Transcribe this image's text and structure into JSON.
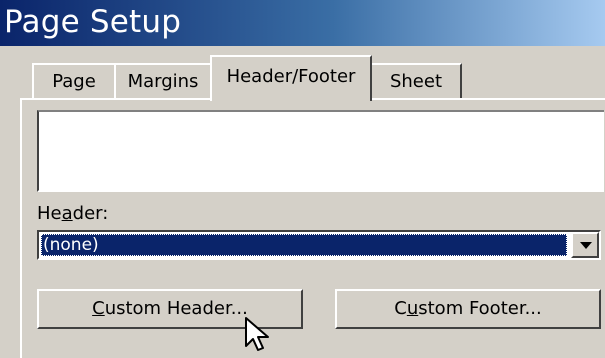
{
  "window": {
    "title": "Page Setup"
  },
  "tabs": [
    {
      "label": "Page",
      "active": false
    },
    {
      "label": "Margins",
      "active": false
    },
    {
      "label": "Header/Footer",
      "active": true
    },
    {
      "label": "Sheet",
      "active": false
    }
  ],
  "header": {
    "label_pre": "He",
    "label_accel": "a",
    "label_post": "der:",
    "selected_value": "(none)"
  },
  "buttons": {
    "custom_header_accel": "C",
    "custom_header_rest": "ustom Header...",
    "custom_footer_pre": "C",
    "custom_footer_accel": "u",
    "custom_footer_rest": "stom Footer..."
  },
  "icons": {
    "dropdown_arrow": "chevron-down-icon",
    "cursor": "mouse-pointer-icon"
  },
  "colors": {
    "title_bar": "#0a246a",
    "selection": "#0a246a",
    "face": "#d4d0c8"
  }
}
